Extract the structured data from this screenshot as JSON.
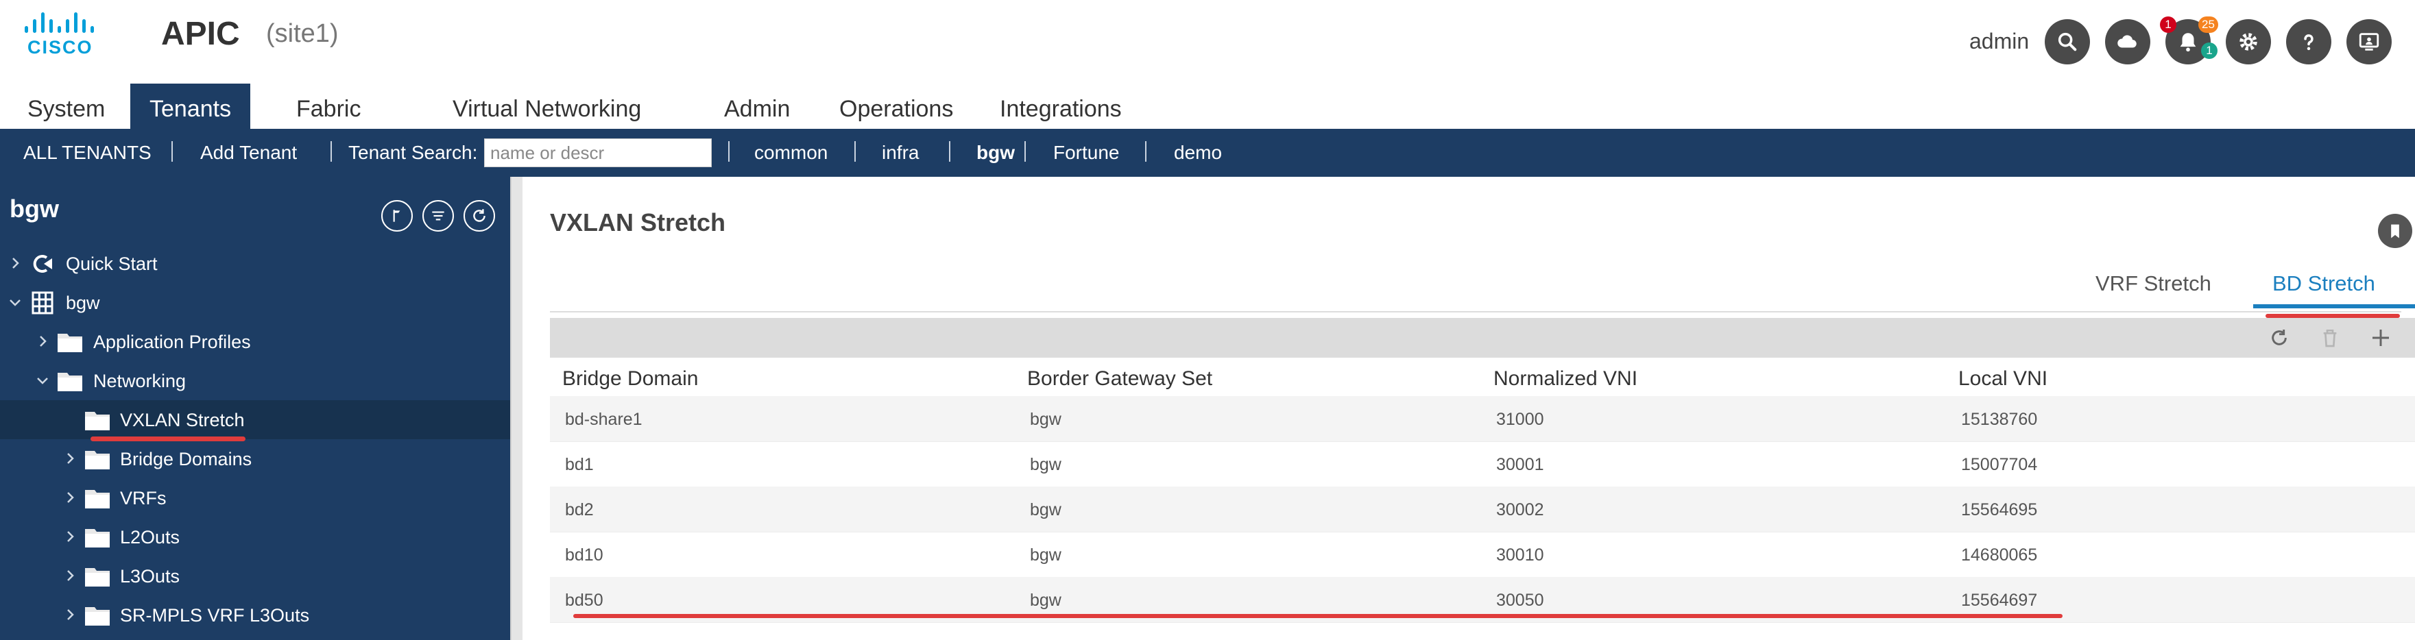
{
  "header": {
    "brand": "CISCO",
    "app_title": "APIC",
    "site": "(site1)",
    "user": "admin",
    "notification_badges": {
      "red": "1",
      "orange": "25",
      "teal": "1"
    },
    "icons": [
      "search-icon",
      "cloud-icon",
      "bell-icon",
      "gear-icon",
      "help-icon",
      "monitor-icon"
    ]
  },
  "main_nav": {
    "tabs": [
      {
        "label": "System"
      },
      {
        "label": "Tenants"
      },
      {
        "label": "Fabric"
      },
      {
        "label": "Virtual Networking"
      },
      {
        "label": "Admin"
      },
      {
        "label": "Operations"
      },
      {
        "label": "Integrations"
      }
    ],
    "active": "Tenants"
  },
  "tenant_bar": {
    "all_tenants": "ALL TENANTS",
    "add_tenant": "Add Tenant",
    "search_label": "Tenant Search:",
    "search_placeholder": "name or descr",
    "tenants": [
      {
        "label": "common"
      },
      {
        "label": "infra"
      },
      {
        "label": "bgw"
      },
      {
        "label": "Fortune"
      },
      {
        "label": "demo"
      }
    ],
    "active_tenant": "bgw"
  },
  "sidebar": {
    "title": "bgw",
    "tree": [
      {
        "label": "Quick Start",
        "icon": "quickstart-icon"
      },
      {
        "label": "bgw",
        "icon": "tenant-grid-icon"
      },
      {
        "label": "Application Profiles",
        "icon": "folder-icon"
      },
      {
        "label": "Networking",
        "icon": "folder-icon"
      },
      {
        "label": "VXLAN Stretch",
        "icon": "folder-icon",
        "selected": true
      },
      {
        "label": "Bridge Domains",
        "icon": "folder-icon"
      },
      {
        "label": "VRFs",
        "icon": "folder-icon"
      },
      {
        "label": "L2Outs",
        "icon": "folder-icon"
      },
      {
        "label": "L3Outs",
        "icon": "folder-icon"
      },
      {
        "label": "SR-MPLS VRF L3Outs",
        "icon": "folder-icon"
      }
    ]
  },
  "content": {
    "title": "VXLAN Stretch",
    "subtabs": [
      {
        "label": "VRF Stretch"
      },
      {
        "label": "BD Stretch"
      }
    ],
    "active_subtab": "BD Stretch",
    "table": {
      "columns": [
        "Bridge Domain",
        "Border Gateway Set",
        "Normalized VNI",
        "Local VNI"
      ],
      "rows": [
        [
          "bd-share1",
          "bgw",
          "31000",
          "15138760"
        ],
        [
          "bd1",
          "bgw",
          "30001",
          "15007704"
        ],
        [
          "bd2",
          "bgw",
          "30002",
          "15564695"
        ],
        [
          "bd10",
          "bgw",
          "30010",
          "14680065"
        ],
        [
          "bd50",
          "bgw",
          "30050",
          "15564697"
        ]
      ]
    }
  },
  "colors": {
    "nav_dark": "#1d3d64",
    "cisco_blue": "#049fd9",
    "active_subtab": "#1b7fbf",
    "annotation_red": "#e03c3c"
  }
}
